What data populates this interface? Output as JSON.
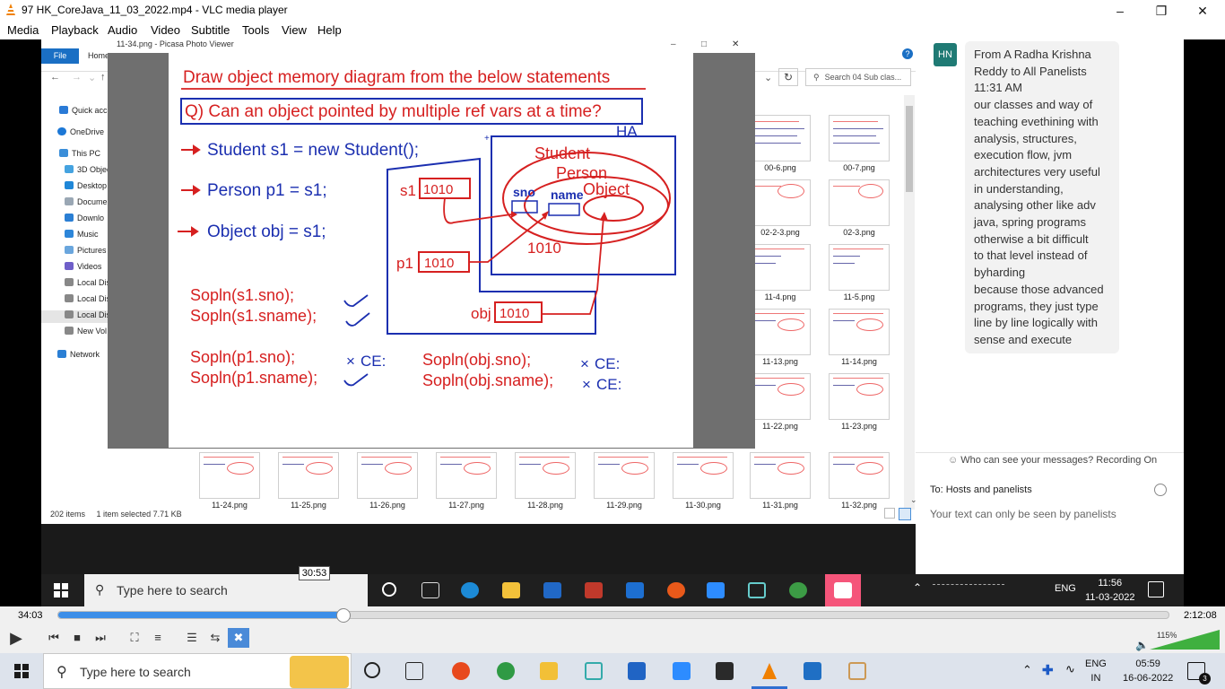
{
  "vlc": {
    "title": "97 HK_CoreJava_11_03_2022.mp4 - VLC media player",
    "menu": [
      "Media",
      "Playback",
      "Audio",
      "Video",
      "Subtitle",
      "Tools",
      "View",
      "Help"
    ],
    "time_current": "34:03",
    "time_total": "2:12:08",
    "progress_fraction": 0.257,
    "seek_tooltip": "30:53",
    "volume": "115%"
  },
  "explorer": {
    "file_tab": "File",
    "home_tab": "Home",
    "search_placeholder": "Search 04 Sub clas...",
    "sidebar": [
      "Quick acc",
      "OneDrive",
      "This PC",
      "3D Objec",
      "Desktop",
      "Docume",
      "Downlo",
      "Music",
      "Pictures",
      "Videos",
      "Local Dis",
      "Local Dis",
      "Local Dis",
      "New Vol",
      "Network"
    ],
    "status_items": "202 items",
    "status_selected": "1 item selected  7.71 KB",
    "thumbnails_right": [
      "00-6.png",
      "00-7.png",
      "02-2-3.png",
      "02-3.png",
      "11-4.png",
      "11-5.png",
      "11-13.png",
      "11-14.png",
      "11-22.png",
      "11-23.png"
    ],
    "thumbnails_bottom": [
      "11-24.png",
      "11-25.png",
      "11-26.png",
      "11-27.png",
      "11-28.png",
      "11-29.png",
      "11-30.png",
      "11-31.png",
      "11-32.png"
    ]
  },
  "picasa": {
    "title": "11-34.png - Picasa Photo Viewer"
  },
  "slide": {
    "heading": "Draw object memory diagram from the below statements",
    "question": "Q) Can an object pointed by multiple ref vars at a time?",
    "statements": [
      "Student s1 = new Student();",
      "Person p1 = s1;",
      "Object obj = s1;"
    ],
    "ha_label": "HA",
    "student_label": "Student",
    "person_label": "Person",
    "object_label": "Object",
    "sno_label": "sno",
    "name_label": "name",
    "s1_label": "s1",
    "p1_label": "p1",
    "obj_label": "obj",
    "ref_value": "1010",
    "addr_label": "1010",
    "code_s1": [
      "Sopln(s1.sno);",
      "Sopln(s1.sname);"
    ],
    "code_p1": [
      "Sopln(p1.sno);",
      "Sopln(p1.sname);"
    ],
    "code_obj": [
      "Sopln(obj.sno);",
      "Sopln(obj.sname);"
    ],
    "ce_mark": "CE:"
  },
  "chat": {
    "avatar": "HN",
    "message": "From A Radha Krishna\nReddy to All Panelists\n11:31 AM\nour classes and way of\nteaching evethining with\nanalysis, structures,\nexecution flow, jvm\narchitectures very useful\nin understanding,\nanalysing other like adv\njava, spring programs\notherwise a bit difficult\nto that level instead of\nbyharding\nbecause those advanced\nprograms, they just type\nline by line logically with\nsense and execute",
    "who": "Who can see your messages? Recording On",
    "to": "To:  Hosts and panelists",
    "private": "Your text can only be seen by panelists"
  },
  "inner_taskbar": {
    "search": "Type here to search",
    "lang": "ENG",
    "time": "11:56",
    "date": "11-03-2022"
  },
  "taskbar": {
    "search": "Type here to search",
    "lang": "ENG",
    "region": "IN",
    "time": "05:59",
    "date": "16-06-2022",
    "notif_count": "3"
  }
}
